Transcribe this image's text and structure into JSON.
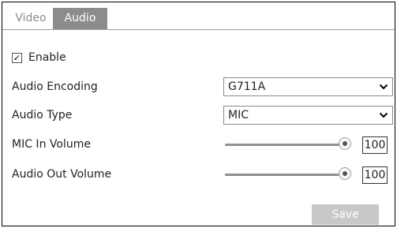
{
  "tabs": [
    {
      "label": "Video",
      "active": false
    },
    {
      "label": "Audio",
      "active": true
    }
  ],
  "enable": {
    "label": "Enable",
    "checked": true
  },
  "audio_encoding": {
    "label": "Audio Encoding",
    "value": "G711A"
  },
  "audio_type": {
    "label": "Audio Type",
    "value": "MIC"
  },
  "mic_in_volume": {
    "label": "MIC In Volume",
    "value": "100",
    "level_fraction": 1.0
  },
  "audio_out_volume": {
    "label": "Audio Out Volume",
    "value": "100",
    "level_fraction": 1.0
  },
  "save": {
    "label": "Save"
  },
  "colors": {
    "active_tab": "#8c8c8c",
    "save_button": "#c8c8c8",
    "slider_track": "#8f8f8f"
  },
  "icons": {
    "dropdown": "chevron-down-icon",
    "checkbox": "checkmark-icon"
  }
}
